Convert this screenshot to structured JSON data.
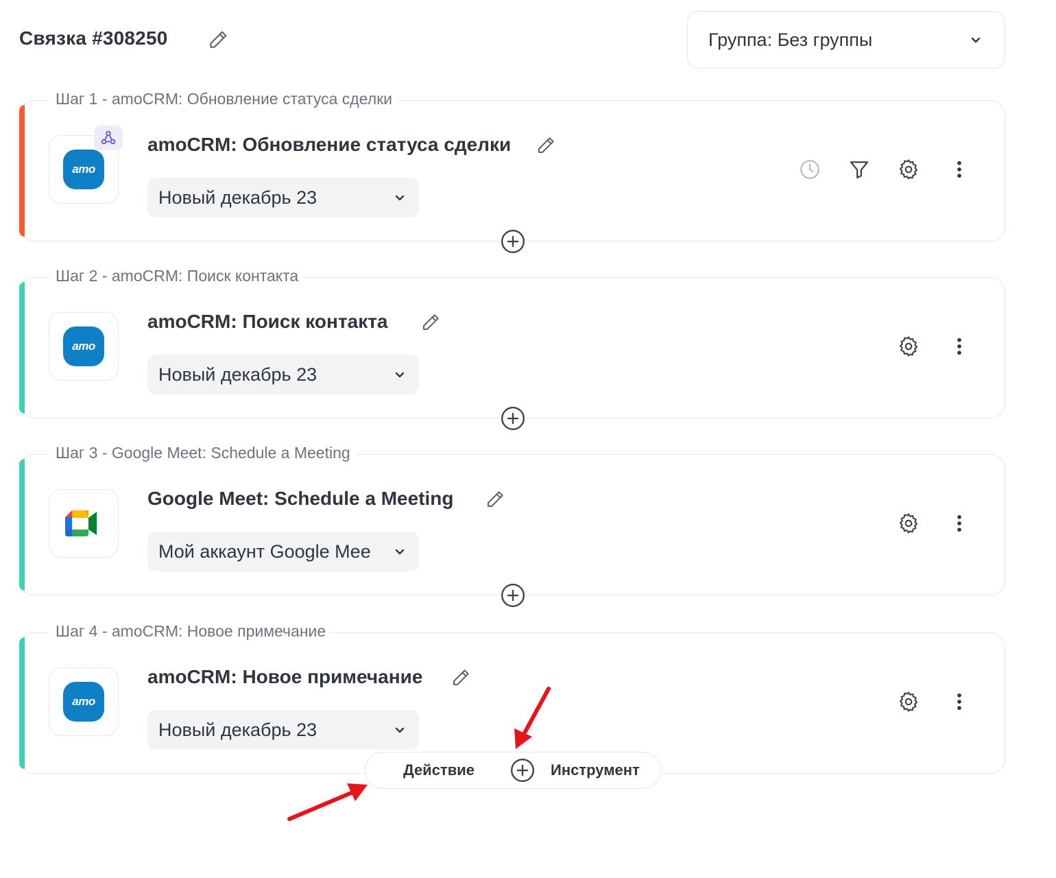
{
  "header": {
    "bundle_title": "Связка #308250",
    "group_label": "Группа: Без группы"
  },
  "colors": {
    "trigger_accent": "#ff5a2b",
    "action_accent": "#3fd1b4",
    "amo_blue": "#0f80c5",
    "arrow_red": "#e8141b"
  },
  "steps": [
    {
      "legend": "Шаг 1 - amoCRM: Обновление статуса сделки",
      "title": "amoCRM: Обновление статуса сделки",
      "logo": "amo",
      "logo_text": "amo",
      "account": "Новый декабрь 23",
      "actions": [
        "clock-icon",
        "filter-icon",
        "gear-icon",
        "more-icon"
      ]
    },
    {
      "legend": "Шаг 2 - amoCRM: Поиск контакта",
      "title": "amoCRM: Поиск контакта",
      "logo": "amo",
      "logo_text": "amo",
      "account": "Новый декабрь 23",
      "actions": [
        "gear-icon",
        "more-icon"
      ]
    },
    {
      "legend": "Шаг 3 - Google Meet: Schedule a Meeting",
      "title": "Google Meet: Schedule a Meeting",
      "logo": "google-meet",
      "account": "Мой аккаунт Google Mee",
      "actions": [
        "gear-icon",
        "more-icon"
      ]
    },
    {
      "legend": "Шаг 4 - amoCRM: Новое примечание",
      "title": "amoCRM: Новое примечание",
      "logo": "amo",
      "logo_text": "amo",
      "account": "Новый декабрь 23",
      "actions": [
        "gear-icon",
        "more-icon"
      ]
    }
  ],
  "add_menu": {
    "action_label": "Действие",
    "tool_label": "Инструмент"
  }
}
